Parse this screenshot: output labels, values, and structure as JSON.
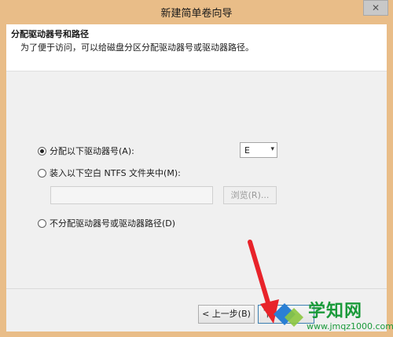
{
  "window": {
    "title": "新建简单卷向导"
  },
  "header": {
    "title": "分配驱动器号和路径",
    "subtitle": "为了便于访问，可以给磁盘分区分配驱动器号或驱动器路径。"
  },
  "options": {
    "assign_letter": {
      "label": "分配以下驱动器号(A):",
      "selected": true
    },
    "mount_folder": {
      "label": "装入以下空白 NTFS 文件夹中(M):",
      "selected": false
    },
    "no_assign": {
      "label": "不分配驱动器号或驱动器路径(D)",
      "selected": false
    }
  },
  "drive_select": {
    "value": "E"
  },
  "folder_path": {
    "value": ""
  },
  "buttons": {
    "browse": "浏览(R)...",
    "back": "< 上一步(B)",
    "next": "下"
  },
  "watermark": {
    "name": "学知网",
    "url": "www.jmqz1000.com"
  },
  "colors": {
    "titlebar": "#e9bd88",
    "arrow": "#e8232a",
    "watermark": "#1a9a3a"
  }
}
